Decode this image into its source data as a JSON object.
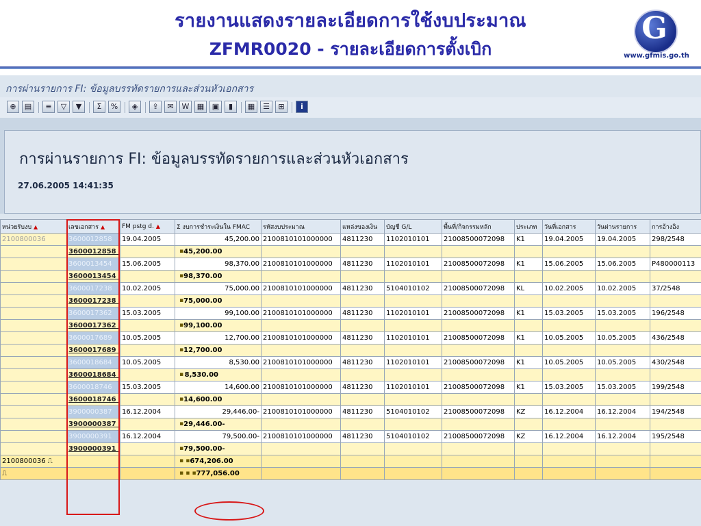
{
  "header": {
    "title_line1": "รายงานแสดงรายละเอียดการใช้งบประมาณ",
    "title_line2": "ZFMR0020 - รายละเอียดการตั้งเบิก",
    "logo_text": "GFMIS",
    "logo_url": "www.gfmis.go.th"
  },
  "screen_title": "การผ่านรายการ FI: ข้อมูลบรรทัดรายการและส่วนหัวเอกสาร",
  "report": {
    "title": "การผ่านรายการ FI: ข้อมูลบรรทัดรายการและส่วนหัวเอกสาร",
    "datetime": "27.06.2005 14:41:35"
  },
  "toolbar": {
    "icons": [
      "detail-icon",
      "select-icon",
      "print-icon",
      "filter-icon",
      "filter-delete-icon",
      "sum-icon",
      "subtotal-icon",
      "layout-icon",
      "export-icon",
      "email-icon",
      "word-icon",
      "spreadsheet-icon",
      "file-icon",
      "graphic-icon",
      "grid-icon",
      "list-icon",
      "abc-icon",
      "info-icon"
    ]
  },
  "table": {
    "headers": [
      "หน่วยรับงบ",
      "เลขเอกสาร",
      "FM pstg d.",
      "Σ งบการชำระเงินใน FMAC",
      "รหัสงบประมาณ",
      "แหล่งของเงิน",
      "บัญชี G/L",
      "พื้นที่/กิจกรรมหลัก",
      "ประเภท",
      "วันที่เอกสาร",
      "วันผ่านรายการ",
      "การอ้างอิง"
    ],
    "unit": "2100800036",
    "rows": [
      {
        "doc": "3600012858",
        "fm_date": "19.04.2005",
        "amount": "45,200.00",
        "budget": "2100810101000000",
        "fund": "4811230",
        "gl": "1102010101",
        "area": "21008500072098",
        "type": "K1",
        "doc_date": "19.04.2005",
        "post_date": "19.04.2005",
        "ref": "298/2548"
      },
      {
        "doc": "3600013454",
        "fm_date": "15.06.2005",
        "amount": "98,370.00",
        "budget": "2100810101000000",
        "fund": "4811230",
        "gl": "1102010101",
        "area": "21008500072098",
        "type": "K1",
        "doc_date": "15.06.2005",
        "post_date": "15.06.2005",
        "ref": "P480000113"
      },
      {
        "doc": "3600017238",
        "fm_date": "10.02.2005",
        "amount": "75,000.00",
        "budget": "2100810101000000",
        "fund": "4811230",
        "gl": "5104010102",
        "area": "21008500072098",
        "type": "KL",
        "doc_date": "10.02.2005",
        "post_date": "10.02.2005",
        "ref": "37/2548"
      },
      {
        "doc": "3600017362",
        "fm_date": "15.03.2005",
        "amount": "99,100.00",
        "budget": "2100810101000000",
        "fund": "4811230",
        "gl": "1102010101",
        "area": "21008500072098",
        "type": "K1",
        "doc_date": "15.03.2005",
        "post_date": "15.03.2005",
        "ref": "196/2548"
      },
      {
        "doc": "3600017689",
        "fm_date": "10.05.2005",
        "amount": "12,700.00",
        "budget": "2100810101000000",
        "fund": "4811230",
        "gl": "1102010101",
        "area": "21008500072098",
        "type": "K1",
        "doc_date": "10.05.2005",
        "post_date": "10.05.2005",
        "ref": "436/2548"
      },
      {
        "doc": "3600018684",
        "fm_date": "10.05.2005",
        "amount": "8,530.00",
        "budget": "2100810101000000",
        "fund": "4811230",
        "gl": "1102010101",
        "area": "21008500072098",
        "type": "K1",
        "doc_date": "10.05.2005",
        "post_date": "10.05.2005",
        "ref": "430/2548"
      },
      {
        "doc": "3600018746",
        "fm_date": "15.03.2005",
        "amount": "14,600.00",
        "budget": "2100810101000000",
        "fund": "4811230",
        "gl": "1102010101",
        "area": "21008500072098",
        "type": "K1",
        "doc_date": "15.03.2005",
        "post_date": "15.03.2005",
        "ref": "199/2548"
      },
      {
        "doc": "3900000387",
        "fm_date": "16.12.2004",
        "amount": "29,446.00-",
        "budget": "2100810101000000",
        "fund": "4811230",
        "gl": "5104010102",
        "area": "21008500072098",
        "type": "KZ",
        "doc_date": "16.12.2004",
        "post_date": "16.12.2004",
        "ref": "194/2548"
      },
      {
        "doc": "3900000391",
        "fm_date": "16.12.2004",
        "amount": "79,500.00-",
        "budget": "2100810101000000",
        "fund": "4811230",
        "gl": "5104010102",
        "area": "21008500072098",
        "type": "KZ",
        "doc_date": "16.12.2004",
        "post_date": "16.12.2004",
        "ref": "195/2548"
      }
    ],
    "unit_total": "674,206.00",
    "grand_total": "777,056.00",
    "subtotal_marker": "▪",
    "unit_total_marker": "▪ ▪",
    "grand_total_marker": "▪ ▪ ▪"
  }
}
